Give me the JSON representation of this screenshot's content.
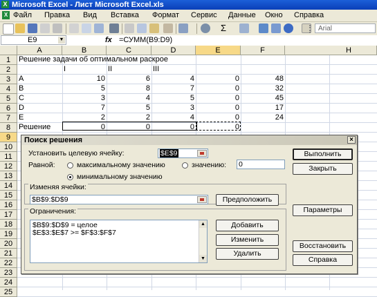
{
  "window": {
    "title": "Microsoft Excel - Лист Microsoft Excel.xls"
  },
  "menu": [
    "Файл",
    "Правка",
    "Вид",
    "Вставка",
    "Формат",
    "Сервис",
    "Данные",
    "Окно",
    "Справка"
  ],
  "toolbar": {
    "font_name": "Arial",
    "sum_symbol": "Σ"
  },
  "formula_bar": {
    "cell_ref": "E9",
    "fx": "fx",
    "formula": "=СУММ(B9:D9)"
  },
  "columns": [
    "A",
    "B",
    "C",
    "D",
    "E",
    "F",
    "H"
  ],
  "rows": [
    "1",
    "2",
    "3",
    "4",
    "5",
    "6",
    "7",
    "8",
    "9",
    "10",
    "11",
    "12",
    "13",
    "14",
    "15",
    "16",
    "17",
    "18",
    "19",
    "20",
    "21",
    "22",
    "23",
    "24",
    "25"
  ],
  "sheet": {
    "a1": "Решение задачи об оптимальном раскрое",
    "headers": [
      "I",
      "II",
      "III"
    ],
    "data_rows": [
      {
        "label": "A",
        "b": "10",
        "c": "6",
        "d": "4",
        "e": "0",
        "f": "48"
      },
      {
        "label": "B",
        "b": "5",
        "c": "8",
        "d": "7",
        "e": "0",
        "f": "32"
      },
      {
        "label": "C",
        "b": "3",
        "c": "4",
        "d": "5",
        "e": "0",
        "f": "45"
      },
      {
        "label": "D",
        "b": "7",
        "c": "5",
        "d": "3",
        "e": "0",
        "f": "17"
      },
      {
        "label": "E",
        "b": "2",
        "c": "2",
        "d": "4",
        "e": "0",
        "f": "24"
      }
    ],
    "solution": {
      "label": "Решение",
      "b": "0",
      "c": "0",
      "d": "0",
      "e": "0"
    }
  },
  "dialog": {
    "title": "Поиск решения",
    "close": "×",
    "target_label": "Установить целевую ячейку:",
    "target_value": "$E$9",
    "equal_label": "Равной:",
    "radio_max": "максимальному значению",
    "radio_value": "значению:",
    "value_field": "0",
    "radio_min": "минимальному значению",
    "changing_label": "Изменяя ячейки:",
    "changing_value": "$B$9:$D$9",
    "guess_button": "Предположить",
    "constraints_label": "Ограничения:",
    "constraints": [
      "$B$9:$D$9 = целое",
      "$E$3:$E$7 >= $F$3:$F$7"
    ],
    "add_button": "Добавить",
    "change_button": "Изменить",
    "delete_button": "Удалить",
    "solve_button": "Выполнить",
    "close_button": "Закрыть",
    "options_button": "Параметры",
    "reset_button": "Восстановить",
    "help_button": "Справка"
  }
}
